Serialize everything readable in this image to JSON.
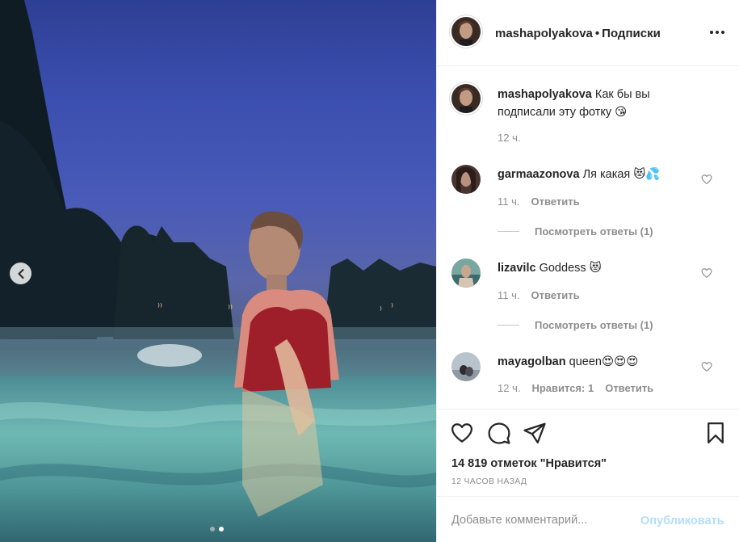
{
  "post": {
    "username": "mashapolyakova",
    "separator": "•",
    "follow_label": "Подписки",
    "more_icon": "more-dots-icon"
  },
  "caption": {
    "username": "mashapolyakova",
    "text": "Как бы вы подписали эту фотку 😘",
    "time": "12 ч."
  },
  "comments": [
    {
      "username": "garmaazonova",
      "text": "Ля какая 😻💦",
      "time": "11 ч.",
      "reply_label": "Ответить",
      "view_replies": "Посмотреть ответы (1)"
    },
    {
      "username": "lizavilc",
      "text": "Goddess 😻",
      "time": "11 ч.",
      "reply_label": "Ответить",
      "view_replies": "Посмотреть ответы (1)"
    },
    {
      "username": "mayagolban",
      "text": "queen😍😍😍",
      "time": "12 ч.",
      "likes_label": "Нравится: 1",
      "reply_label": "Ответить"
    }
  ],
  "actions": {
    "likes": "14 819 отметок \"Нравится\"",
    "posted_time": "12 ЧАСОВ НАЗАД"
  },
  "add_comment": {
    "placeholder": "Добавьте комментарий...",
    "post_label": "Опубликовать"
  },
  "carousel": {
    "current": 2,
    "total": 2
  },
  "colors": {
    "link_disabled": "#b2dffc",
    "muted": "#8e8e8e",
    "text": "#262626"
  }
}
